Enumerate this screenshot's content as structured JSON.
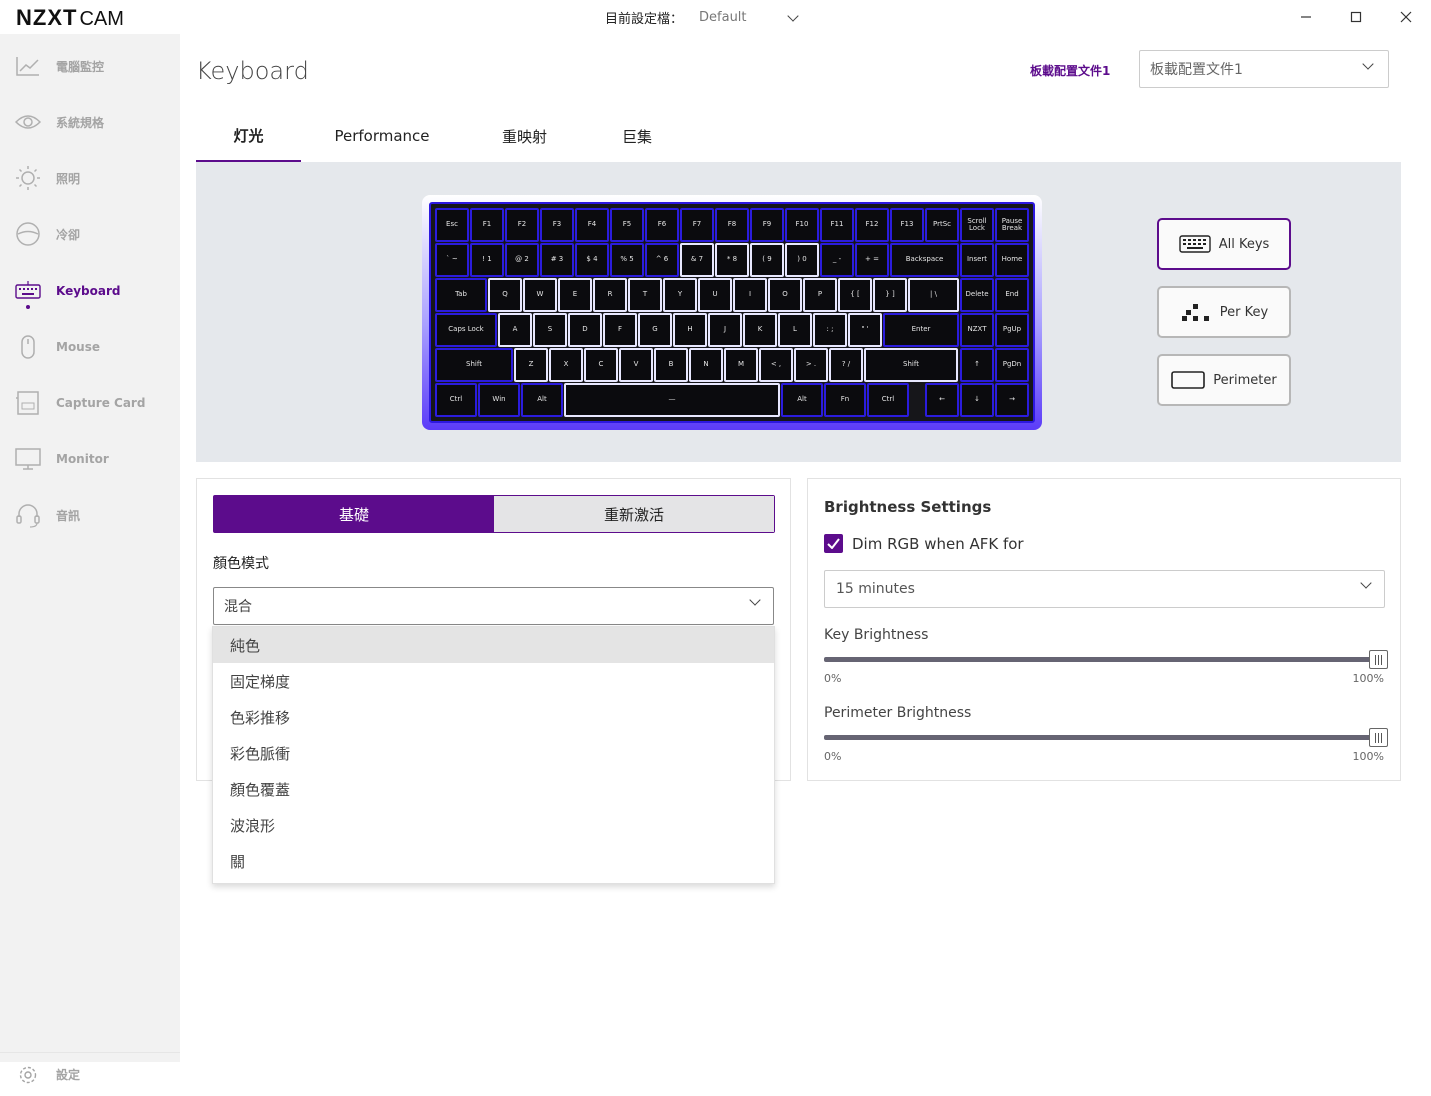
{
  "app": {
    "logo_main": "NZXT",
    "logo_sub": "CAM"
  },
  "titlebar": {
    "profile_label": "目前設定檔：",
    "profile_value": "Default"
  },
  "sidebar": {
    "items": [
      {
        "label": "電腦監控",
        "icon": "chart-line-icon"
      },
      {
        "label": "系統規格",
        "icon": "eye-icon"
      },
      {
        "label": "照明",
        "icon": "sun-icon"
      },
      {
        "label": "冷卻",
        "icon": "fan-icon"
      },
      {
        "label": "Keyboard",
        "icon": "keyboard-icon",
        "active": true
      },
      {
        "label": "Mouse",
        "icon": "mouse-icon"
      },
      {
        "label": "Capture Card",
        "icon": "capture-card-icon"
      },
      {
        "label": "Monitor",
        "icon": "monitor-icon"
      },
      {
        "label": "音訊",
        "icon": "headset-icon"
      }
    ],
    "settings_label": "設定"
  },
  "header": {
    "title": "Keyboard",
    "config_label": "板載配置文件1",
    "config_value": "板載配置文件1"
  },
  "tabs": [
    "灯光",
    "Performance",
    "重映射",
    "巨集"
  ],
  "keyboard": {
    "rows": [
      [
        "Esc",
        "F1",
        "F2",
        "F3",
        "F4",
        "F5",
        "F6",
        "F7",
        "F8",
        "F9",
        "F10",
        "F11",
        "F12",
        "F13",
        "PrtSc",
        "Scroll Lock",
        "Pause Break"
      ],
      [
        "` ~",
        "! 1",
        "@ 2",
        "# 3",
        "$ 4",
        "% 5",
        "^ 6",
        "& 7",
        "* 8",
        "( 9",
        ") 0",
        "_ -",
        "+ =",
        "Backspace",
        "Insert",
        "Home"
      ],
      [
        "Tab",
        "Q",
        "W",
        "E",
        "R",
        "T",
        "Y",
        "U",
        "I",
        "O",
        "P",
        "{ [",
        "} ]",
        "| \\",
        "Delete",
        "End"
      ],
      [
        "Caps Lock",
        "A",
        "S",
        "D",
        "F",
        "G",
        "H",
        "J",
        "K",
        "L",
        ": ;",
        "\" '",
        "Enter",
        "NZXT",
        "PgUp"
      ],
      [
        "Shift",
        "Z",
        "X",
        "C",
        "V",
        "B",
        "N",
        "M",
        "< ,",
        "> .",
        "? /",
        "Shift",
        "↑",
        "PgDn"
      ],
      [
        "Ctrl",
        "Win",
        "Alt",
        "—",
        "Alt",
        "Fn",
        "Ctrl",
        "←",
        "↓",
        "→"
      ]
    ],
    "accent": "#2b1cdd"
  },
  "lighting_modes": {
    "all_keys": "All Keys",
    "per_key": "Per Key",
    "perimeter": "Perimeter"
  },
  "left_panel": {
    "seg_basic": "基礎",
    "seg_reactive": "重新激活",
    "color_mode_label": "顏色模式",
    "color_mode_value": "混合",
    "options": [
      "純色",
      "固定梯度",
      "色彩推移",
      "彩色脈衝",
      "顏色覆蓋",
      "波浪形",
      "關"
    ]
  },
  "brightness": {
    "title": "Brightness Settings",
    "dim_label": "Dim RGB when AFK for",
    "dim_checked": true,
    "afk_value": "15 minutes",
    "key_label": "Key Brightness",
    "key_value": 100,
    "perimeter_label": "Perimeter Brightness",
    "perimeter_value": 100,
    "min_label": "0%",
    "max_label": "100%"
  },
  "colors": {
    "brand_purple": "#5c0c8c"
  }
}
